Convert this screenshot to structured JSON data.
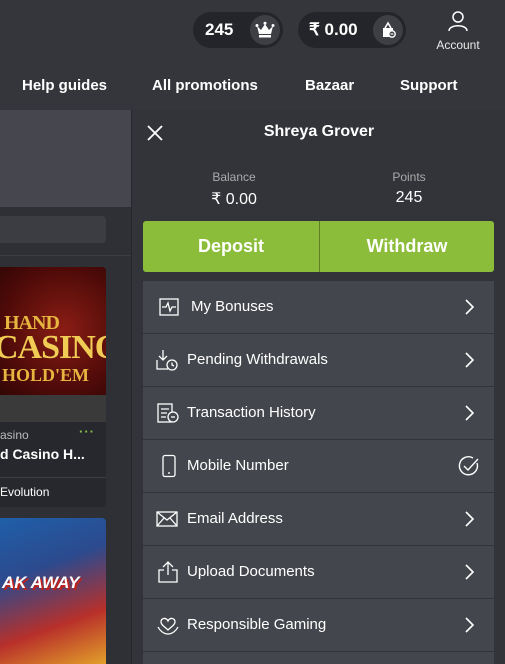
{
  "header": {
    "points_value": "245",
    "balance_value": "₹ 0.00",
    "account_label": "Account"
  },
  "nav": [
    {
      "label": "Help guides"
    },
    {
      "label": "All promotions"
    },
    {
      "label": "Bazaar"
    },
    {
      "label": "Support"
    }
  ],
  "background": {
    "card1": {
      "art_line1": "HAND",
      "art_line2": "CASINO",
      "art_line3": "HOLD'EM",
      "subtitle": "asino",
      "menu_dots": "···",
      "title": "d Casino H...",
      "provider": "Evolution"
    },
    "card2": {
      "art_text": "AK AWAY"
    }
  },
  "panel": {
    "user_name": "Shreya Grover",
    "balance_label": "Balance",
    "balance_value": "₹ 0.00",
    "points_label": "Points",
    "points_value": "245",
    "deposit_label": "Deposit",
    "withdraw_label": "Withdraw",
    "menu": [
      {
        "label": "My Bonuses",
        "icon": "bonus-icon",
        "right_icon": "chevron-right-icon"
      },
      {
        "label": "Pending Withdrawals",
        "icon": "pending-withdrawal-icon",
        "right_icon": "chevron-right-icon"
      },
      {
        "label": "Transaction History",
        "icon": "transaction-history-icon",
        "right_icon": "chevron-right-icon"
      },
      {
        "label": "Mobile Number",
        "icon": "mobile-phone-icon",
        "right_icon": "verified-check-icon"
      },
      {
        "label": "Email Address",
        "icon": "email-icon",
        "right_icon": "chevron-right-icon"
      },
      {
        "label": "Upload Documents",
        "icon": "upload-icon",
        "right_icon": "chevron-right-icon"
      },
      {
        "label": "Responsible Gaming",
        "icon": "responsible-gaming-icon",
        "right_icon": "chevron-right-icon"
      }
    ]
  },
  "colors": {
    "accent_green": "#8cbd3a",
    "panel_bg": "#32343a",
    "menu_item_bg": "#44464d",
    "header_bg": "#35363c"
  }
}
